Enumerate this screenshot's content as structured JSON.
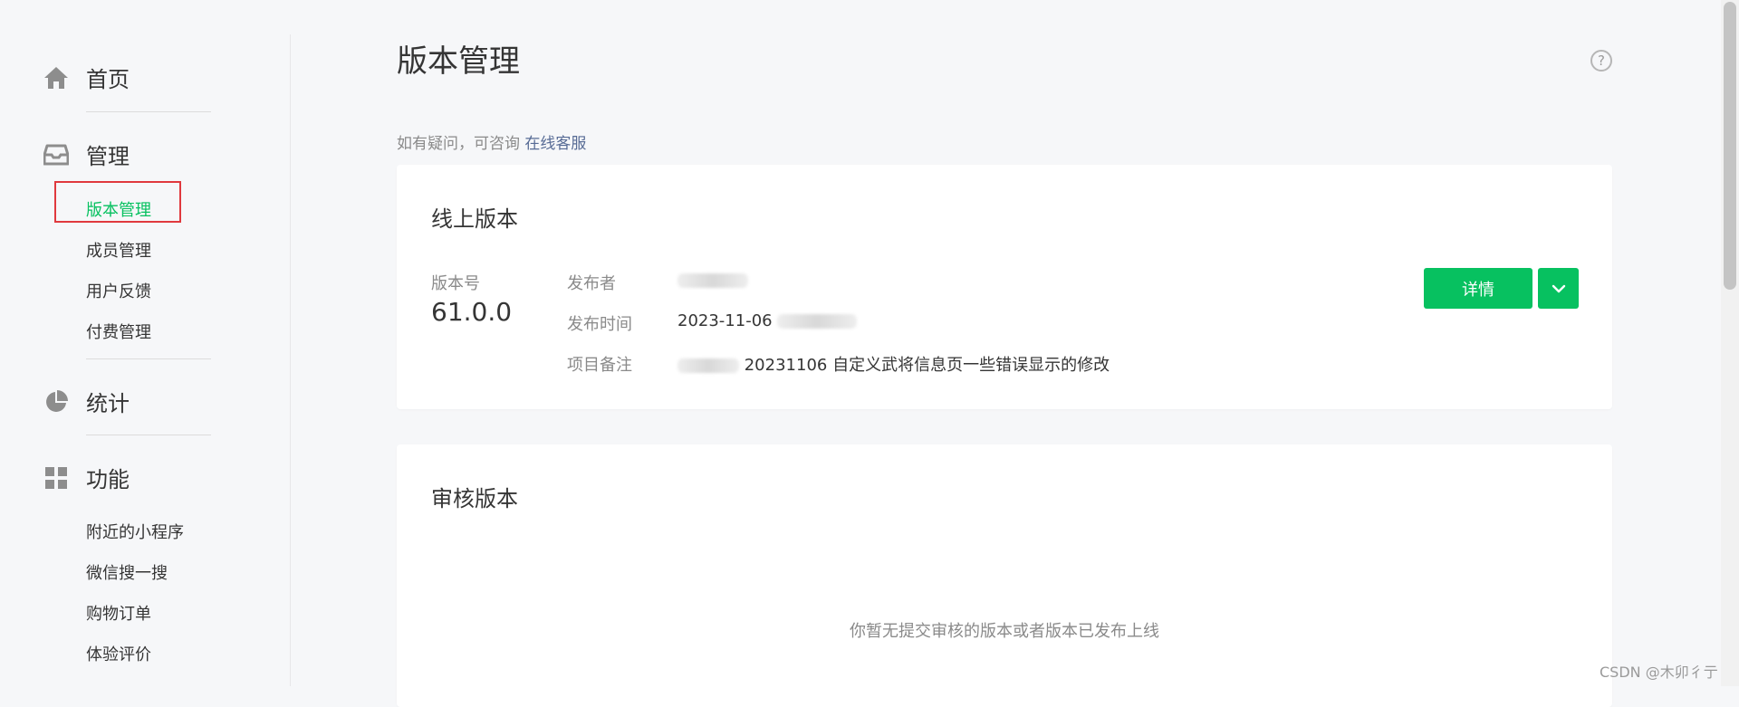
{
  "sidebar": {
    "home": {
      "label": "首页",
      "icon": "home-icon"
    },
    "manage": {
      "label": "管理",
      "icon": "inbox-icon",
      "items": [
        {
          "label": "版本管理",
          "active": true
        },
        {
          "label": "成员管理"
        },
        {
          "label": "用户反馈"
        },
        {
          "label": "付费管理"
        }
      ]
    },
    "stats": {
      "label": "统计",
      "icon": "pie-chart-icon"
    },
    "features": {
      "label": "功能",
      "icon": "grid-icon",
      "items": [
        {
          "label": "附近的小程序"
        },
        {
          "label": "微信搜一搜"
        },
        {
          "label": "购物订单"
        },
        {
          "label": "体验评价"
        }
      ]
    }
  },
  "main": {
    "title": "版本管理",
    "consult_prefix": "如有疑问，可咨询",
    "consult_link": "在线客服",
    "online": {
      "title": "线上版本",
      "version_label": "版本号",
      "version": "61.0.0",
      "publisher_label": "发布者",
      "publish_time_label": "发布时间",
      "publish_time": "2023-11-06",
      "remark_label": "项目备注",
      "remark": "20231106 自定义武将信息页一些错误显示的修改",
      "detail_button": "详情"
    },
    "review": {
      "title": "审核版本",
      "empty_text": "你暂无提交审核的版本或者版本已发布上线"
    }
  },
  "watermark": "CSDN @木卯彳亍",
  "colors": {
    "accent": "#07c160",
    "link": "#576b95",
    "highlight_box": "#e0393e"
  }
}
